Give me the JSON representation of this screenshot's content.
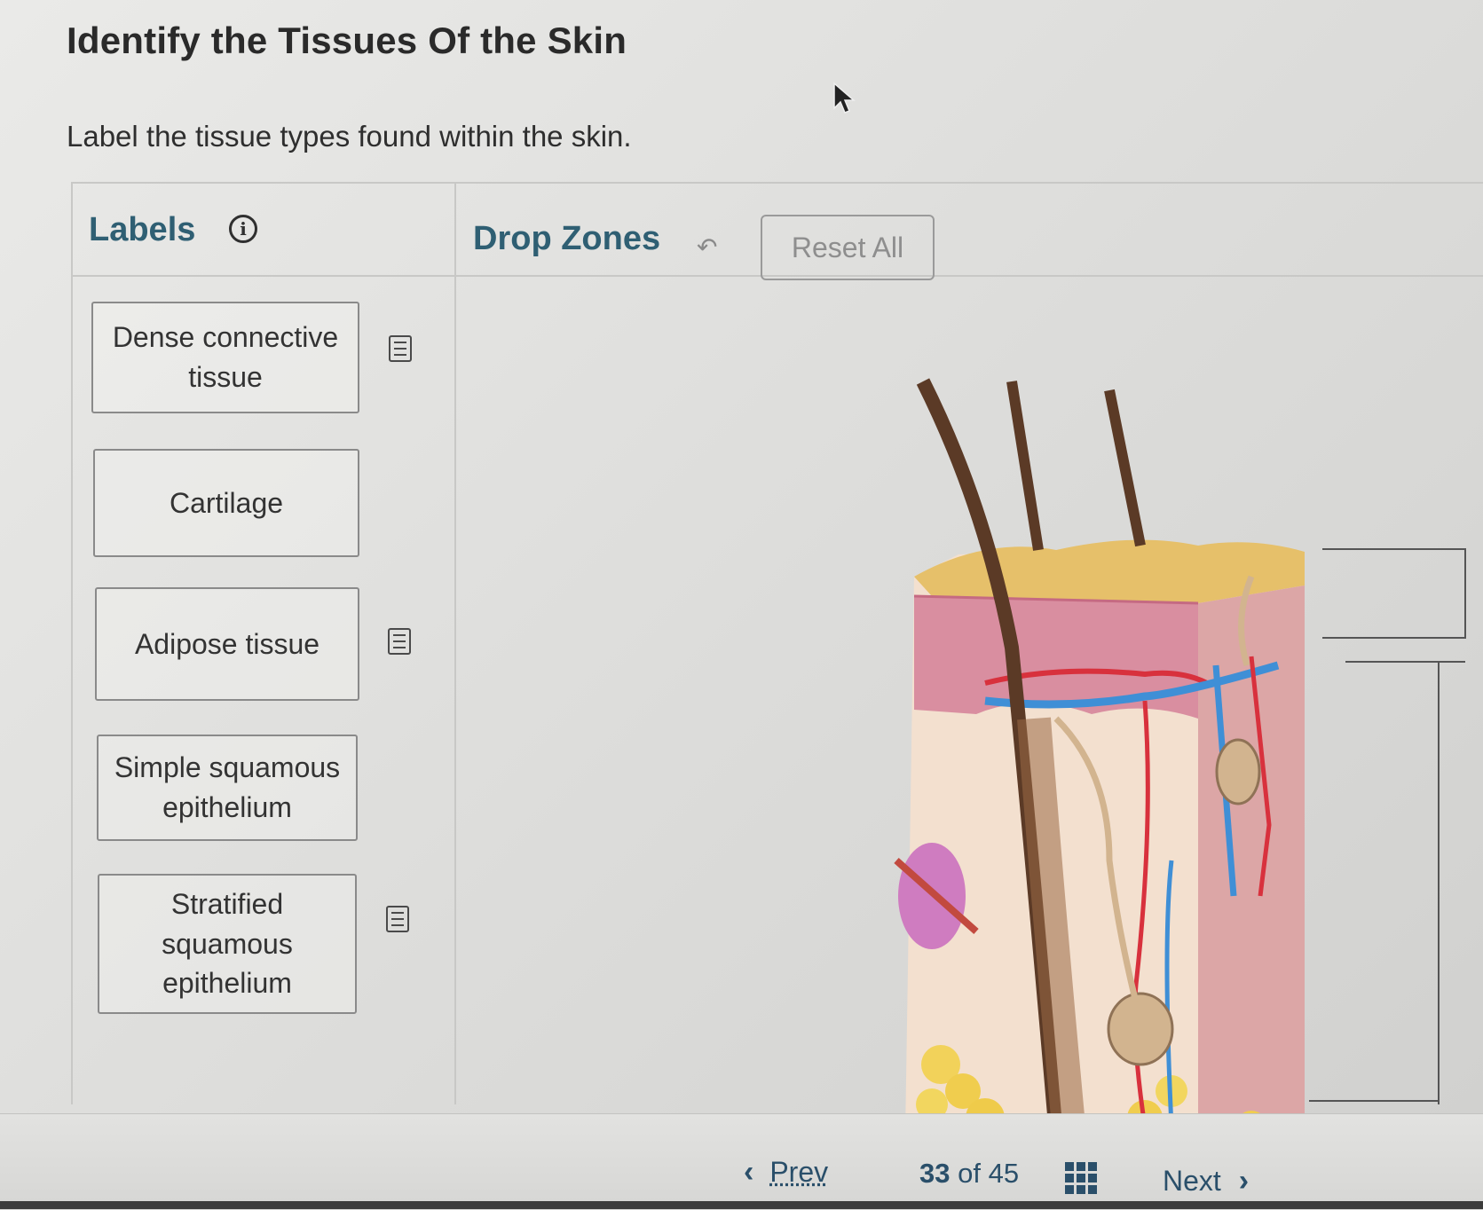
{
  "header": {
    "title": "Identify the Tissues Of the Skin",
    "instruction": "Label the tissue types found within the skin."
  },
  "labels_panel": {
    "heading": "Labels",
    "items": [
      {
        "label": "Dense connective tissue",
        "has_note": true
      },
      {
        "label": "Cartilage",
        "has_note": false
      },
      {
        "label": "Adipose tissue",
        "has_note": true
      },
      {
        "label": "Simple squamous epithelium",
        "has_note": false
      },
      {
        "label": "Stratified squamous epithelium",
        "has_note": true
      }
    ]
  },
  "drop_zones": {
    "heading": "Drop Zones",
    "reset_label": "Reset All"
  },
  "pagination": {
    "prev_label": "Prev",
    "current": "33",
    "of_label": "of",
    "total": "45",
    "next_label": "Next"
  },
  "icons": {
    "info": "info-icon",
    "undo": "undo-icon",
    "note": "note-icon",
    "grid": "grid-icon",
    "chevron_left": "chevron-left-icon",
    "chevron_right": "chevron-right-icon"
  },
  "colors": {
    "heading_accent": "#2f5f73",
    "nav_accent": "#2a4f6a"
  }
}
